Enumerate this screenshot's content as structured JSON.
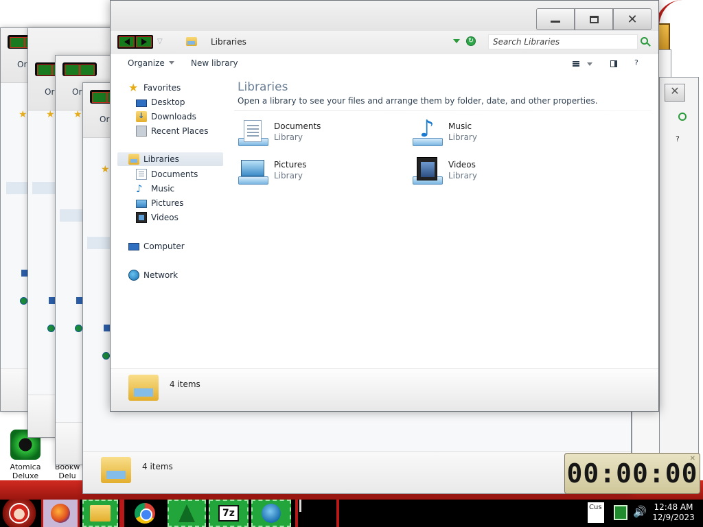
{
  "window": {
    "title_path": "Libraries",
    "search_placeholder": "Search Libraries",
    "caption": {
      "minimize": "—",
      "maximize": "☐",
      "close": "✕"
    }
  },
  "toolbar": {
    "organize": "Organize",
    "new_library": "New library",
    "help": "?"
  },
  "nav": {
    "favorites": "Favorites",
    "desktop": "Desktop",
    "downloads": "Downloads",
    "recent_places": "Recent Places",
    "libraries": "Libraries",
    "documents": "Documents",
    "music": "Music",
    "pictures": "Pictures",
    "videos": "Videos",
    "computer": "Computer",
    "network": "Network"
  },
  "content": {
    "title": "Libraries",
    "subtitle": "Open a library to see your files and arrange them by folder, date, and other properties.",
    "items": [
      {
        "name": "Documents",
        "kind": "Library",
        "icon": "documents-library-icon"
      },
      {
        "name": "Music",
        "kind": "Library",
        "icon": "music-library-icon"
      },
      {
        "name": "Pictures",
        "kind": "Library",
        "icon": "pictures-library-icon"
      },
      {
        "name": "Videos",
        "kind": "Library",
        "icon": "videos-library-icon"
      }
    ]
  },
  "status": {
    "count": "4 items"
  },
  "ghost_windows": {
    "organize_fragment": "Or",
    "status": "4 items"
  },
  "desktop_icons": {
    "atomica_line1": "Atomica",
    "atomica_line2": "Deluxe",
    "bookworm_line1": "Bookw",
    "bookworm_line2": "Delu"
  },
  "timer": {
    "display": "00:00:00"
  },
  "taskbar": {
    "seven_zip_label": "7z",
    "tray_cust": "Cus",
    "clock_time": "12:48 AM",
    "clock_date": "12/9/2023"
  },
  "colors": {
    "taskbar_bg": "#000000",
    "taskbar_green": "#22a53a",
    "accent_red": "#b81a1a",
    "title_gray": "#6a7f96"
  }
}
